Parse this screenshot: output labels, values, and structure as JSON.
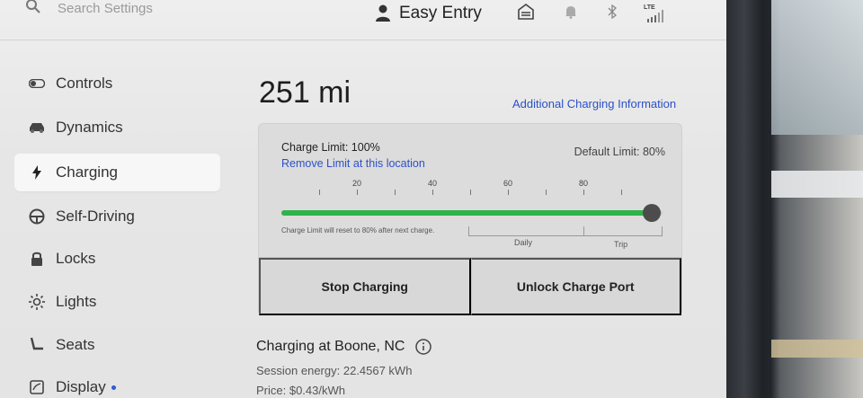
{
  "search": {
    "placeholder": "Search Settings"
  },
  "profile": {
    "name": "Easy Entry"
  },
  "status": {
    "signal_label": "LTE"
  },
  "sidebar": {
    "items": [
      {
        "label": "Controls",
        "icon": "toggle-icon"
      },
      {
        "label": "Dynamics",
        "icon": "car-icon"
      },
      {
        "label": "Charging",
        "icon": "bolt-icon",
        "active": true
      },
      {
        "label": "Self-Driving",
        "icon": "steering-wheel-icon"
      },
      {
        "label": "Locks",
        "icon": "lock-icon"
      },
      {
        "label": "Lights",
        "icon": "sun-icon"
      },
      {
        "label": "Seats",
        "icon": "seat-icon"
      },
      {
        "label": "Display",
        "icon": "display-icon",
        "badge": true
      }
    ]
  },
  "main": {
    "range": "251 mi",
    "more_info_link": "Additional Charging Information",
    "charge_limit_label": "Charge Limit: 100%",
    "remove_limit_link": "Remove Limit at this location",
    "default_limit": "Default Limit: 80%",
    "scale_labels": [
      "20",
      "40",
      "60",
      "80"
    ],
    "charge_limit_percent": 100,
    "reset_note": "Charge Limit will reset to 80% after next charge.",
    "daily_label": "Daily",
    "trip_label": "Trip",
    "stop_button": "Stop Charging",
    "unlock_button": "Unlock Charge Port",
    "location_title": "Charging at Boone, NC",
    "session_energy": "Session energy: 22.4567 kWh",
    "price": "Price: $0.43/kWh"
  },
  "colors": {
    "accent_link": "#2c50c8",
    "charge_fill": "#2fb34b",
    "badge_dot": "#2f5bd3"
  }
}
